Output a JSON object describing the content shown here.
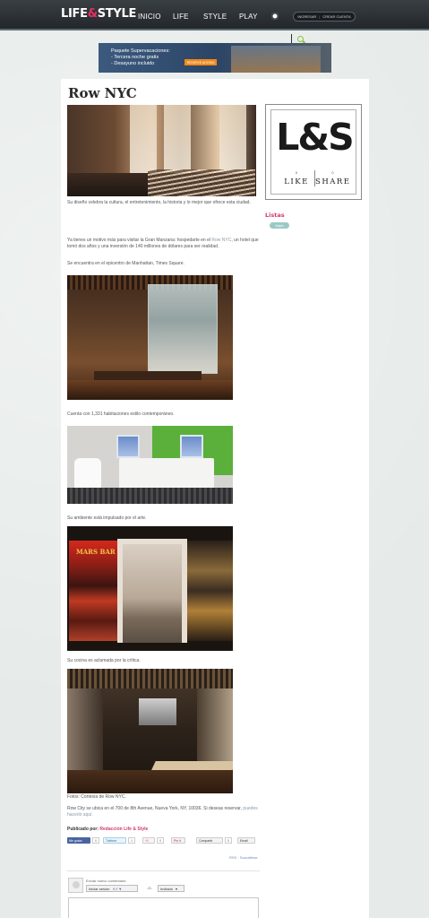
{
  "brand": {
    "name_left": "LIFE",
    "amp": "&",
    "name_right": "STYLE"
  },
  "nav": [
    {
      "label": "INICIO"
    },
    {
      "label": "LIFE"
    },
    {
      "label": "STYLE"
    },
    {
      "label": "PLAY"
    }
  ],
  "auth": {
    "login": "INGRESAR",
    "separator": "|",
    "register": "CREAR CUENTA"
  },
  "ad": {
    "line1": "Paquete Supervacaciones:",
    "line2": "- Tercera noche gratis",
    "line3": "- Desayuno incluido",
    "cta": "RESERVE AHORA!"
  },
  "post": {
    "title": "Row NYC",
    "para1": "Su diseño celebra la cultura, el entretenimiento, la historia y lo mejor que ofrece esta ciudad.",
    "para2_a": "Ya tienes un motivo más para visitar la Gran Manzana: hospedarte en el ",
    "para2_link": "Row NYC",
    "para2_b": ", un hotel que tomó dos años y una inversión de 140 millones de dólares para ser realidad.",
    "para3": "Se encuentra en el epicentro de Manhattan, Times Square.",
    "caption2": "Cuenta con 1,331 habitaciones estilo contemporáneo.",
    "caption3": "Su ambiente está impulsado por el arte.",
    "caption4": "Su cocina es aclamada por la crítica.",
    "photo_credit": "Fotos: Cortesía de Row NYC.",
    "address_a": "Row City se ubica en el 700 de 8th Avenue, Nueva York, NY, 10036. Si deseas reservar, ",
    "address_link": "puedes hacerlo aquí.",
    "published_label": "Publicado por:",
    "author": "Redacción Life & Style",
    "bar_sign": "MARS BAR"
  },
  "share": {
    "fb_label": "Me gusta",
    "fb_count": "0",
    "tw_label": "Twittear",
    "tw_count": "1",
    "gplus_label": "+1",
    "gplus_count": "0",
    "pin_label": "Pin it",
    "share_label": "Compartir",
    "share_count": "0",
    "email_label": "Email"
  },
  "links": {
    "rss": "RSS",
    "subscribe": "Suscribirse"
  },
  "comments": {
    "prompt": "Enviar nuevo comentario:",
    "login_button": "Iniciar sesión",
    "or_text": "-O-",
    "guest_button": "Invitado"
  },
  "sidebar": {
    "logo_text": "L&S",
    "like_count": "0",
    "like_word": "LIKE",
    "share_count": "0",
    "share_word": "SHARE",
    "lists_title": "Listas",
    "tag_label": "Viajes"
  },
  "colors": {
    "accent": "#d23a68",
    "nav_bg": "#2b2f33",
    "link": "#8a9ba8"
  }
}
